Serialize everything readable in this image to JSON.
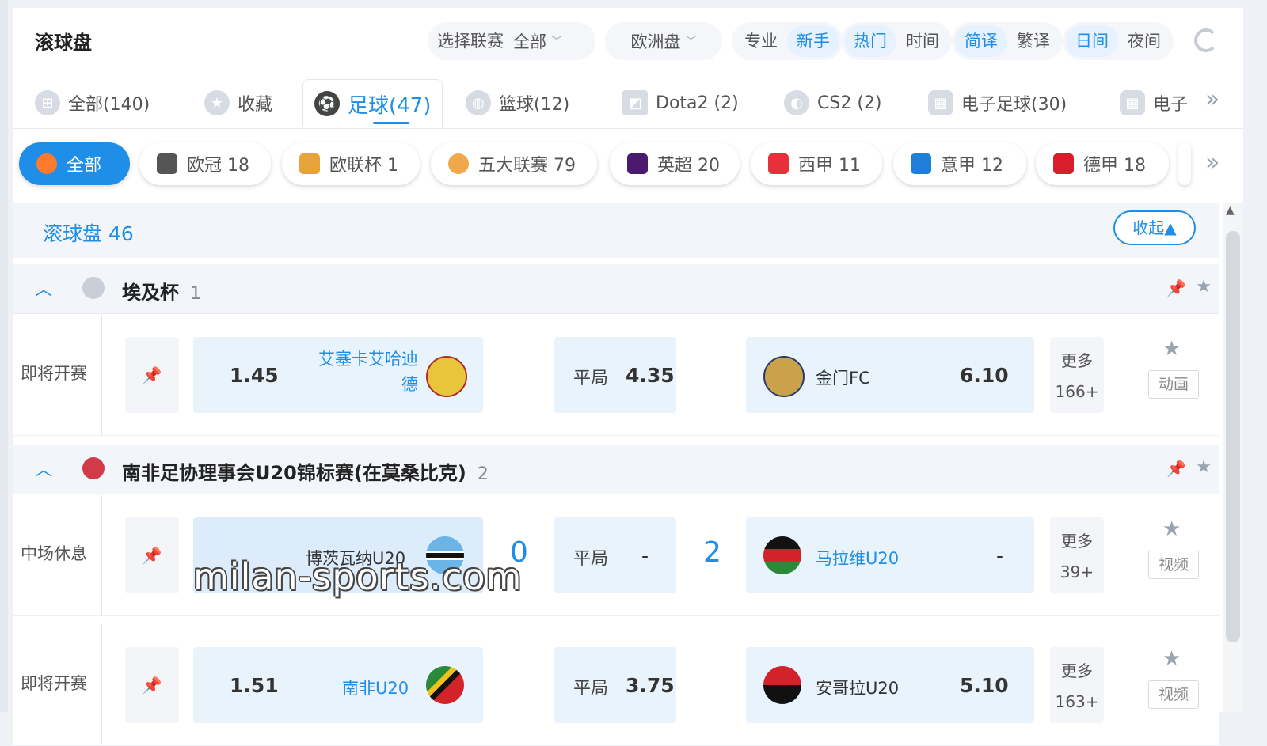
{
  "topbar": {
    "title": "滚球盘",
    "league_select": "选择联赛",
    "league_value": "全部",
    "odds_type": "欧洲盘",
    "mode_pro": "专业",
    "mode_novice": "新手",
    "sort_hot": "热门",
    "sort_time": "时间",
    "lang_simplified": "简译",
    "lang_traditional": "繁译",
    "theme_day": "日间",
    "theme_night": "夜间"
  },
  "sport_tabs": [
    {
      "label": "全部(140)",
      "icon": "grid-icon"
    },
    {
      "label": "收藏",
      "icon": "star-icon"
    },
    {
      "label": "足球(47)",
      "icon": "soccer-ball-icon",
      "active": true
    },
    {
      "label": "篮球(12)",
      "icon": "basketball-icon"
    },
    {
      "label": "Dota2 (2)",
      "icon": "dota2-icon"
    },
    {
      "label": "CS2 (2)",
      "icon": "cs2-icon"
    },
    {
      "label": "电子足球(30)",
      "icon": "esoccer-icon"
    },
    {
      "label": "电子",
      "icon": "ebasket-icon"
    }
  ],
  "league_chips": [
    {
      "label": "全部",
      "active": true
    },
    {
      "label": "欧冠 18"
    },
    {
      "label": "欧联杯 1"
    },
    {
      "label": "五大联赛 79"
    },
    {
      "label": "英超 20"
    },
    {
      "label": "西甲 11"
    },
    {
      "label": "意甲 12"
    },
    {
      "label": "德甲 18"
    }
  ],
  "live_header": {
    "label": "滚球盘 46",
    "collapse": "收起▲"
  },
  "leagues": [
    {
      "name": "埃及杯",
      "count": "1",
      "matches": [
        {
          "status": "即将开赛",
          "home": "艾塞卡艾哈迪德",
          "home_odds": "1.45",
          "draw_label": "平局",
          "draw_odds": "4.35",
          "away": "金门FC",
          "away_odds": "6.10",
          "more": "更多",
          "more_count": "166+",
          "media": "动画"
        }
      ]
    },
    {
      "name": "南非足协理事会U20锦标赛(在莫桑比克)",
      "count": "2",
      "matches": [
        {
          "status": "中场休息",
          "home": "博茨瓦纳U20",
          "home_score": "0",
          "draw_label": "平局",
          "draw_odds": "-",
          "away_score": "2",
          "away": "马拉维U20",
          "away_odds": "-",
          "more": "更多",
          "more_count": "39+",
          "media": "视频"
        },
        {
          "status": "即将开赛",
          "home": "南非U20",
          "home_odds": "1.51",
          "draw_label": "平局",
          "draw_odds": "3.75",
          "away": "安哥拉U20",
          "away_odds": "5.10",
          "more": "更多",
          "more_count": "163+",
          "media": "视频"
        }
      ]
    }
  ],
  "watermark": "milan-sports.com",
  "colors": {
    "accent": "#1e8ee8",
    "odds_box": "#e9f3fc",
    "chip_active_icon": "#ff7b2b"
  }
}
